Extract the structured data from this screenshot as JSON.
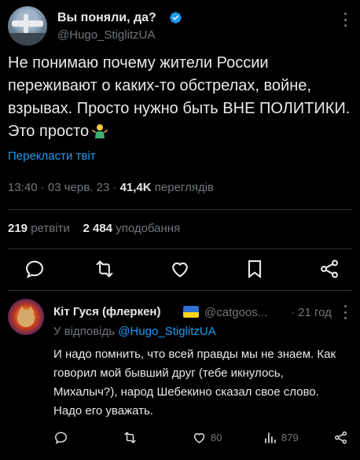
{
  "tweet": {
    "display_name": "Вы поняли, да?",
    "handle": "@Hugo_StiglitzUA",
    "text": "Не понимаю почему жители России переживают о каких-то обстрелах, войне, взрывах. Просто нужно быть ВНЕ ПОЛИТИКИ. Это просто",
    "emoji": "person-shrugging-emoji",
    "translate_label": "Перекласти твіт",
    "time": "13:40",
    "date": "03 черв. 23",
    "views_count": "41,4K",
    "views_label": "переглядів",
    "retweets_count": "219",
    "retweets_label": "ретвіти",
    "likes_count": "2 484",
    "likes_label": "уподобання"
  },
  "reply": {
    "display_name": "Кіт Гуся (флеркен)",
    "handle": "@catgoos...",
    "time": "· 21 год",
    "reply_to_prefix": "У відповідь",
    "reply_to_handle": "@Hugo_StiglitzUA",
    "text": "И надо помнить, что всей правды мы не знаем. Как говорил мой бывший друг (тебе икнулось, Михалыч?), народ Шебекино сказал свое слово. Надо его уважать.",
    "likes": "80",
    "views": "879"
  },
  "colors": {
    "background": "#000000",
    "text_primary": "#e7e9ea",
    "text_secondary": "#71767b",
    "accent": "#1d9bf0",
    "divider": "#2f3336"
  }
}
